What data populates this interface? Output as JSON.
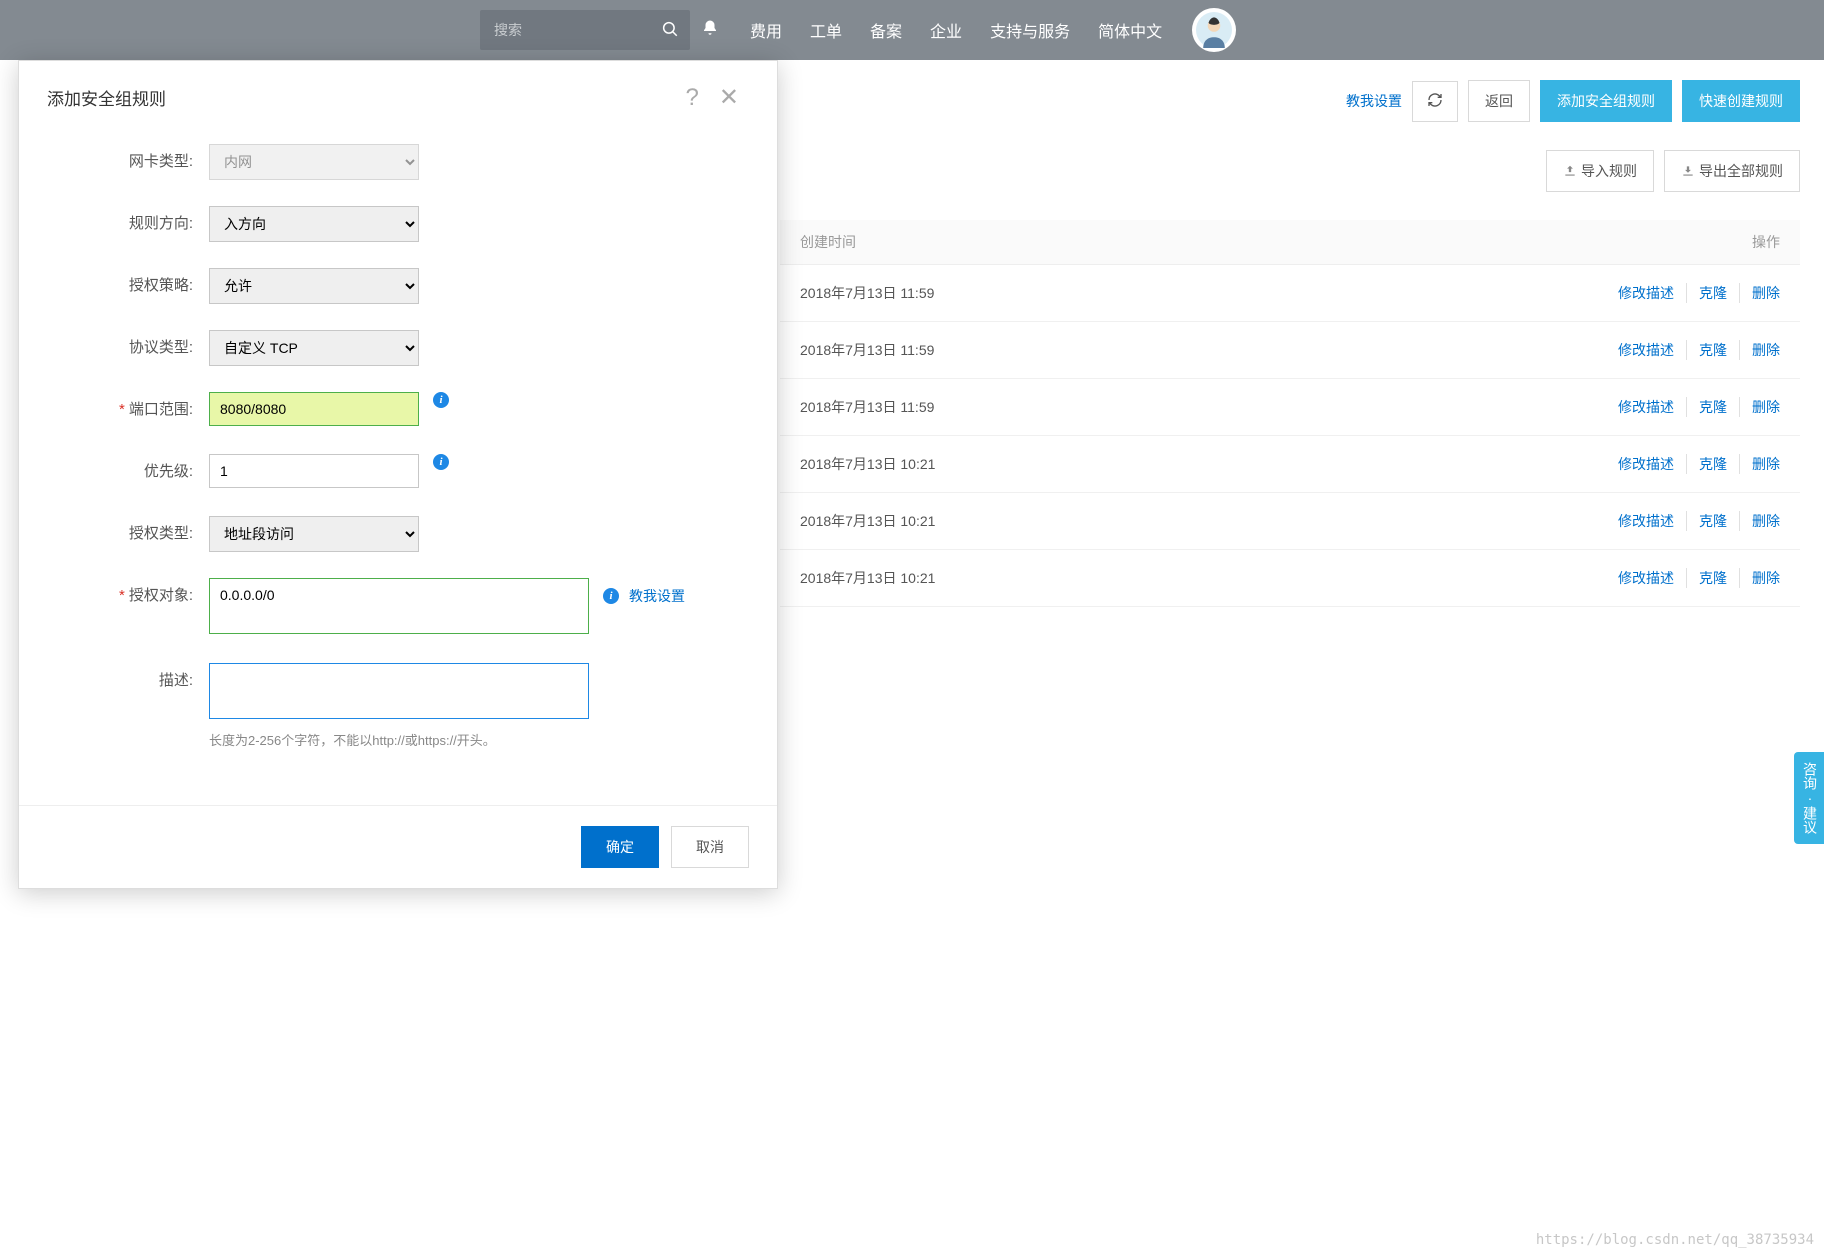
{
  "nav": {
    "search_placeholder": "搜索",
    "items": [
      "费用",
      "工单",
      "备案",
      "企业",
      "支持与服务",
      "简体中文"
    ]
  },
  "page": {
    "teach_me": "教我设置",
    "back": "返回",
    "add_rule": "添加安全组规则",
    "quick_create": "快速创建规则",
    "import_rules": "导入规则",
    "export_all": "导出全部规则"
  },
  "table": {
    "col_time": "创建时间",
    "col_ops": "操作",
    "op_edit_desc": "修改描述",
    "op_clone": "克隆",
    "op_delete": "删除",
    "rows": [
      {
        "time": "2018年7月13日 11:59"
      },
      {
        "time": "2018年7月13日 11:59"
      },
      {
        "time": "2018年7月13日 11:59"
      },
      {
        "time": "2018年7月13日 10:21"
      },
      {
        "time": "2018年7月13日 10:21"
      },
      {
        "time": "2018年7月13日 10:21"
      }
    ]
  },
  "modal": {
    "title": "添加安全组规则",
    "labels": {
      "nic_type": "网卡类型:",
      "direction": "规则方向:",
      "policy": "授权策略:",
      "protocol": "协议类型:",
      "port_range": "端口范围:",
      "priority": "优先级:",
      "auth_type": "授权类型:",
      "auth_object": "授权对象:",
      "description": "描述:"
    },
    "values": {
      "nic_type": "内网",
      "direction": "入方向",
      "policy": "允许",
      "protocol": "自定义 TCP",
      "port_range": "8080/8080",
      "priority": "1",
      "auth_type": "地址段访问",
      "auth_object": "0.0.0.0/0",
      "description": ""
    },
    "desc_hint": "长度为2-256个字符，不能以http://或https://开头。",
    "teach_me": "教我设置",
    "ok": "确定",
    "cancel": "取消"
  },
  "side_tab": "咨询·建议",
  "watermark": "https://blog.csdn.net/qq_38735934"
}
